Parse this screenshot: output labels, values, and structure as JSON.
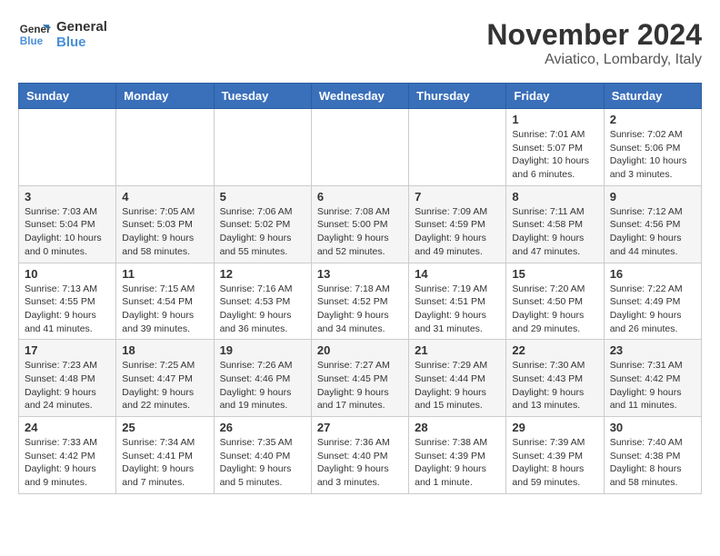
{
  "logo": {
    "line1": "General",
    "line2": "Blue"
  },
  "header": {
    "month": "November 2024",
    "location": "Aviatico, Lombardy, Italy"
  },
  "weekdays": [
    "Sunday",
    "Monday",
    "Tuesday",
    "Wednesday",
    "Thursday",
    "Friday",
    "Saturday"
  ],
  "weeks": [
    [
      {
        "day": "",
        "info": ""
      },
      {
        "day": "",
        "info": ""
      },
      {
        "day": "",
        "info": ""
      },
      {
        "day": "",
        "info": ""
      },
      {
        "day": "",
        "info": ""
      },
      {
        "day": "1",
        "info": "Sunrise: 7:01 AM\nSunset: 5:07 PM\nDaylight: 10 hours and 6 minutes."
      },
      {
        "day": "2",
        "info": "Sunrise: 7:02 AM\nSunset: 5:06 PM\nDaylight: 10 hours and 3 minutes."
      }
    ],
    [
      {
        "day": "3",
        "info": "Sunrise: 7:03 AM\nSunset: 5:04 PM\nDaylight: 10 hours and 0 minutes."
      },
      {
        "day": "4",
        "info": "Sunrise: 7:05 AM\nSunset: 5:03 PM\nDaylight: 9 hours and 58 minutes."
      },
      {
        "day": "5",
        "info": "Sunrise: 7:06 AM\nSunset: 5:02 PM\nDaylight: 9 hours and 55 minutes."
      },
      {
        "day": "6",
        "info": "Sunrise: 7:08 AM\nSunset: 5:00 PM\nDaylight: 9 hours and 52 minutes."
      },
      {
        "day": "7",
        "info": "Sunrise: 7:09 AM\nSunset: 4:59 PM\nDaylight: 9 hours and 49 minutes."
      },
      {
        "day": "8",
        "info": "Sunrise: 7:11 AM\nSunset: 4:58 PM\nDaylight: 9 hours and 47 minutes."
      },
      {
        "day": "9",
        "info": "Sunrise: 7:12 AM\nSunset: 4:56 PM\nDaylight: 9 hours and 44 minutes."
      }
    ],
    [
      {
        "day": "10",
        "info": "Sunrise: 7:13 AM\nSunset: 4:55 PM\nDaylight: 9 hours and 41 minutes."
      },
      {
        "day": "11",
        "info": "Sunrise: 7:15 AM\nSunset: 4:54 PM\nDaylight: 9 hours and 39 minutes."
      },
      {
        "day": "12",
        "info": "Sunrise: 7:16 AM\nSunset: 4:53 PM\nDaylight: 9 hours and 36 minutes."
      },
      {
        "day": "13",
        "info": "Sunrise: 7:18 AM\nSunset: 4:52 PM\nDaylight: 9 hours and 34 minutes."
      },
      {
        "day": "14",
        "info": "Sunrise: 7:19 AM\nSunset: 4:51 PM\nDaylight: 9 hours and 31 minutes."
      },
      {
        "day": "15",
        "info": "Sunrise: 7:20 AM\nSunset: 4:50 PM\nDaylight: 9 hours and 29 minutes."
      },
      {
        "day": "16",
        "info": "Sunrise: 7:22 AM\nSunset: 4:49 PM\nDaylight: 9 hours and 26 minutes."
      }
    ],
    [
      {
        "day": "17",
        "info": "Sunrise: 7:23 AM\nSunset: 4:48 PM\nDaylight: 9 hours and 24 minutes."
      },
      {
        "day": "18",
        "info": "Sunrise: 7:25 AM\nSunset: 4:47 PM\nDaylight: 9 hours and 22 minutes."
      },
      {
        "day": "19",
        "info": "Sunrise: 7:26 AM\nSunset: 4:46 PM\nDaylight: 9 hours and 19 minutes."
      },
      {
        "day": "20",
        "info": "Sunrise: 7:27 AM\nSunset: 4:45 PM\nDaylight: 9 hours and 17 minutes."
      },
      {
        "day": "21",
        "info": "Sunrise: 7:29 AM\nSunset: 4:44 PM\nDaylight: 9 hours and 15 minutes."
      },
      {
        "day": "22",
        "info": "Sunrise: 7:30 AM\nSunset: 4:43 PM\nDaylight: 9 hours and 13 minutes."
      },
      {
        "day": "23",
        "info": "Sunrise: 7:31 AM\nSunset: 4:42 PM\nDaylight: 9 hours and 11 minutes."
      }
    ],
    [
      {
        "day": "24",
        "info": "Sunrise: 7:33 AM\nSunset: 4:42 PM\nDaylight: 9 hours and 9 minutes."
      },
      {
        "day": "25",
        "info": "Sunrise: 7:34 AM\nSunset: 4:41 PM\nDaylight: 9 hours and 7 minutes."
      },
      {
        "day": "26",
        "info": "Sunrise: 7:35 AM\nSunset: 4:40 PM\nDaylight: 9 hours and 5 minutes."
      },
      {
        "day": "27",
        "info": "Sunrise: 7:36 AM\nSunset: 4:40 PM\nDaylight: 9 hours and 3 minutes."
      },
      {
        "day": "28",
        "info": "Sunrise: 7:38 AM\nSunset: 4:39 PM\nDaylight: 9 hours and 1 minute."
      },
      {
        "day": "29",
        "info": "Sunrise: 7:39 AM\nSunset: 4:39 PM\nDaylight: 8 hours and 59 minutes."
      },
      {
        "day": "30",
        "info": "Sunrise: 7:40 AM\nSunset: 4:38 PM\nDaylight: 8 hours and 58 minutes."
      }
    ]
  ]
}
